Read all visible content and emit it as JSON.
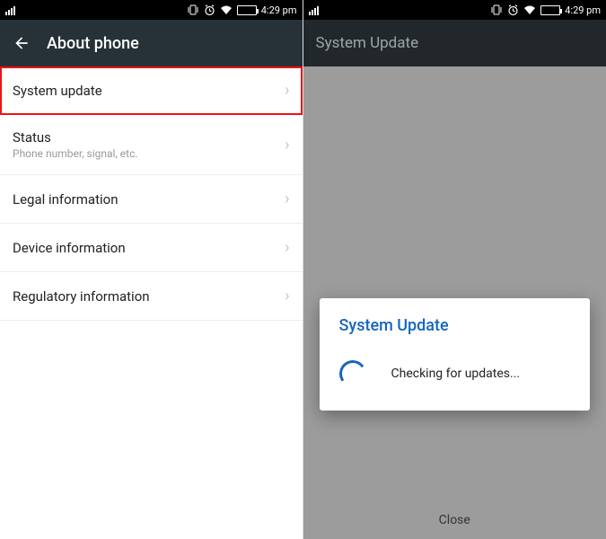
{
  "status_bar": {
    "time": "4:29 pm",
    "icons": [
      "signal",
      "vibrate",
      "alarm",
      "wifi",
      "battery"
    ]
  },
  "left": {
    "header": {
      "title": "About phone"
    },
    "items": [
      {
        "title": "System update",
        "sub": "",
        "highlighted": true
      },
      {
        "title": "Status",
        "sub": "Phone number, signal, etc."
      },
      {
        "title": "Legal information",
        "sub": ""
      },
      {
        "title": "Device information",
        "sub": ""
      },
      {
        "title": "Regulatory information",
        "sub": ""
      }
    ]
  },
  "right": {
    "header": {
      "title": "System Update"
    },
    "dialog": {
      "title": "System Update",
      "message": "Checking for updates..."
    },
    "close_label": "Close"
  }
}
